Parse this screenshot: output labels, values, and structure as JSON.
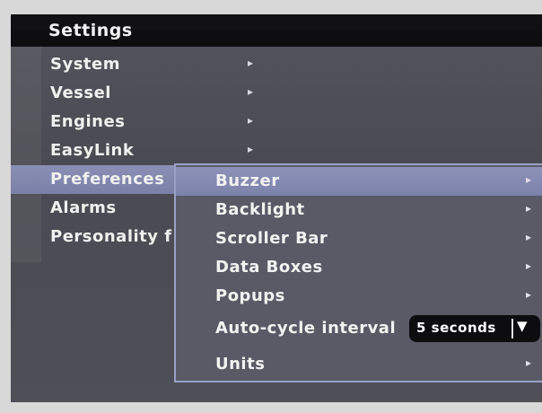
{
  "title": "Settings",
  "main_menu": [
    {
      "label": "System",
      "chevron": "▸"
    },
    {
      "label": "Vessel",
      "chevron": "▸"
    },
    {
      "label": "Engines",
      "chevron": "▸"
    },
    {
      "label": "EasyLink",
      "chevron": "▸"
    },
    {
      "label": "Preferences",
      "chevron": ""
    },
    {
      "label": "Alarms",
      "chevron": ""
    },
    {
      "label": "Personality f",
      "chevron": ""
    }
  ],
  "selected_main": "Preferences",
  "submenu": [
    {
      "label": "Buzzer",
      "chevron": "▸"
    },
    {
      "label": "Backlight",
      "chevron": "▸"
    },
    {
      "label": "Scroller Bar",
      "chevron": "▸"
    },
    {
      "label": "Data Boxes",
      "chevron": "▸"
    },
    {
      "label": "Popups",
      "chevron": "▸"
    },
    {
      "label": "Auto-cycle interval",
      "chevron": ""
    },
    {
      "label": "Units",
      "chevron": "▸"
    }
  ],
  "selected_sub": "Buzzer",
  "auto_cycle": {
    "value": "5 seconds",
    "arrow": "▼"
  },
  "colors": {
    "highlight": "#8a8fb4",
    "background": "#4e4e56",
    "dropdown": "#0d0d10"
  }
}
